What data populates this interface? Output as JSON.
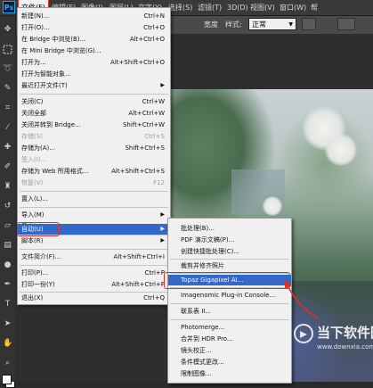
{
  "app": {
    "logo": "Ps"
  },
  "menubar": {
    "items": [
      "文件(F)",
      "编辑(E)",
      "图像(I)",
      "图层(L)",
      "文字(Y)",
      "选择(S)",
      "滤镜(T)",
      "3D(D)",
      "视图(V)",
      "窗口(W)",
      "帮"
    ]
  },
  "options": {
    "width_label": "宽度",
    "style_label": "样式:",
    "style_value": "正常"
  },
  "file_menu": {
    "items": [
      {
        "label": "新建(N)...",
        "shortcut": "Ctrl+N"
      },
      {
        "label": "打开(O)...",
        "shortcut": "Ctrl+O"
      },
      {
        "label": "在 Bridge 中浏览(B)...",
        "shortcut": "Alt+Ctrl+O"
      },
      {
        "label": "在 Mini Bridge 中浏览(G)...",
        "shortcut": ""
      },
      {
        "label": "打开为...",
        "shortcut": "Alt+Shift+Ctrl+O"
      },
      {
        "label": "打开为智能对象...",
        "shortcut": ""
      },
      {
        "label": "最近打开文件(T)",
        "shortcut": ""
      },
      {
        "label": "关闭(C)",
        "shortcut": "Ctrl+W"
      },
      {
        "label": "关闭全部",
        "shortcut": "Alt+Ctrl+W"
      },
      {
        "label": "关闭并转到 Bridge...",
        "shortcut": "Shift+Ctrl+W"
      },
      {
        "label": "存储(S)",
        "shortcut": "Ctrl+S"
      },
      {
        "label": "存储为(A)...",
        "shortcut": "Shift+Ctrl+S"
      },
      {
        "label": "签入(I)...",
        "shortcut": ""
      },
      {
        "label": "存储为 Web 所用格式...",
        "shortcut": "Alt+Shift+Ctrl+S"
      },
      {
        "label": "恢复(V)",
        "shortcut": "F12"
      },
      {
        "label": "置入(L)...",
        "shortcut": ""
      },
      {
        "label": "导入(M)",
        "shortcut": ""
      },
      {
        "label": "导出(E)",
        "shortcut": ""
      },
      {
        "label": "自动(U)",
        "shortcut": ""
      },
      {
        "label": "脚本(R)",
        "shortcut": ""
      },
      {
        "label": "文件简介(F)...",
        "shortcut": "Alt+Shift+Ctrl+I"
      },
      {
        "label": "打印(P)...",
        "shortcut": "Ctrl+P"
      },
      {
        "label": "打印一份(Y)",
        "shortcut": "Alt+Shift+Ctrl+P"
      },
      {
        "label": "退出(X)",
        "shortcut": "Ctrl+Q"
      }
    ]
  },
  "automate_menu": {
    "items": [
      {
        "label": "批处理(B)..."
      },
      {
        "label": "PDF 演示文稿(P)..."
      },
      {
        "label": "创建快捷批处理(C)..."
      },
      {
        "label": "裁剪并修齐照片"
      },
      {
        "label": "Topaz Gigapixel AI..."
      },
      {
        "label": "Imagenomic Plug-in Console..."
      },
      {
        "label": "联系表 II..."
      },
      {
        "label": "Photomerge..."
      },
      {
        "label": "合并到 HDR Pro..."
      },
      {
        "label": "镜头校正..."
      },
      {
        "label": "条件模式更改..."
      },
      {
        "label": "限制图像..."
      }
    ]
  },
  "watermark": {
    "title": "当下软件园",
    "url": "www.downxia.com"
  },
  "colors": {
    "highlight": "#3268c8",
    "annotation_red": "#e0301e"
  }
}
